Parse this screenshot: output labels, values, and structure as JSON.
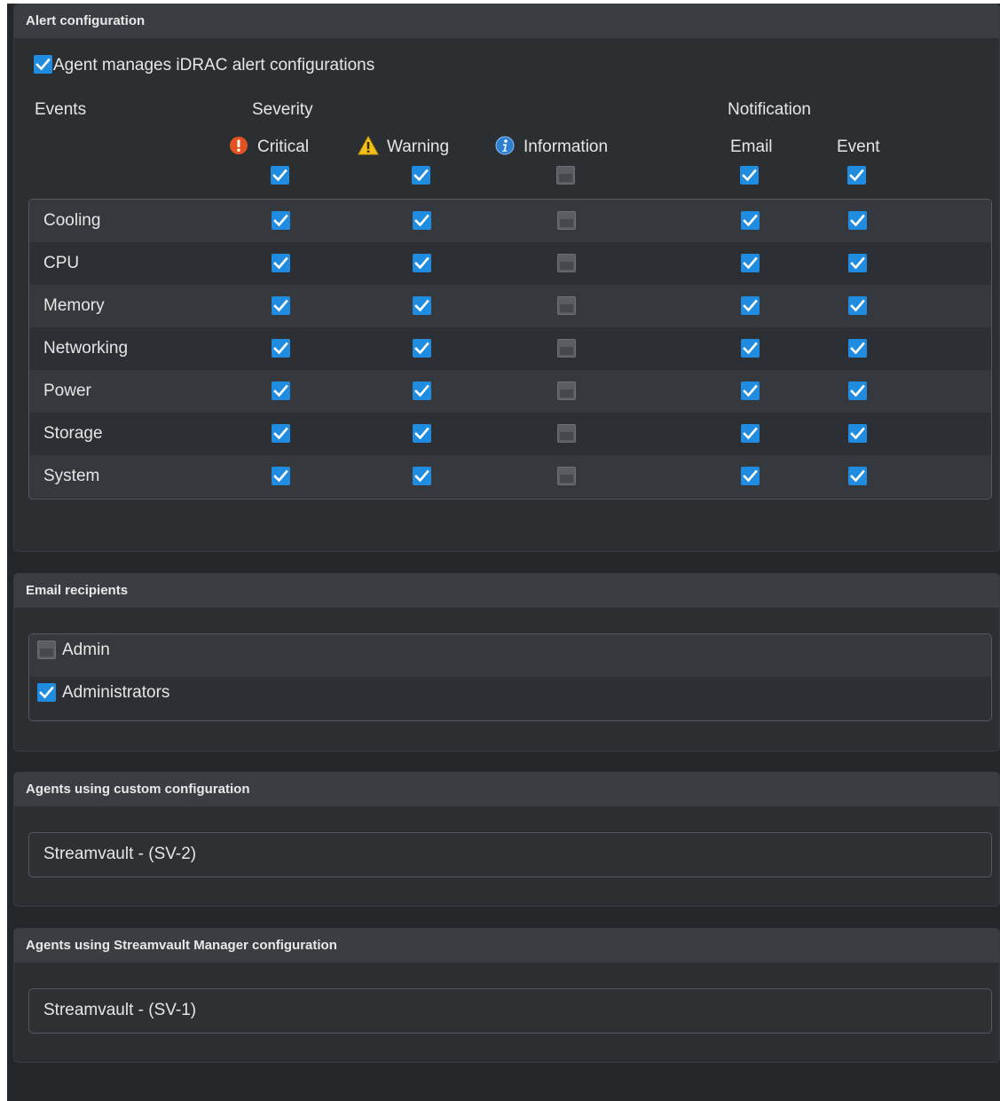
{
  "alert_configuration": {
    "title": "Alert configuration",
    "agent_manages_label": "Agent manages iDRAC alert configurations",
    "agent_manages_checked": true,
    "headers": {
      "events": "Events",
      "severity": "Severity",
      "notification": "Notification",
      "critical": "Critical",
      "warning": "Warning",
      "information": "Information",
      "email": "Email",
      "event": "Event"
    },
    "column_master": {
      "critical": true,
      "warning": true,
      "information": false,
      "email": true,
      "event": true
    },
    "rows": [
      {
        "name": "Cooling",
        "critical": true,
        "warning": true,
        "information": false,
        "email": true,
        "event": true
      },
      {
        "name": "CPU",
        "critical": true,
        "warning": true,
        "information": false,
        "email": true,
        "event": true
      },
      {
        "name": "Memory",
        "critical": true,
        "warning": true,
        "information": false,
        "email": true,
        "event": true
      },
      {
        "name": "Networking",
        "critical": true,
        "warning": true,
        "information": false,
        "email": true,
        "event": true
      },
      {
        "name": "Power",
        "critical": true,
        "warning": true,
        "information": false,
        "email": true,
        "event": true
      },
      {
        "name": "Storage",
        "critical": true,
        "warning": true,
        "information": false,
        "email": true,
        "event": true
      },
      {
        "name": "System",
        "critical": true,
        "warning": true,
        "information": false,
        "email": true,
        "event": true
      }
    ]
  },
  "email_recipients": {
    "title": "Email recipients",
    "items": [
      {
        "label": "Admin",
        "checked": false
      },
      {
        "label": "Administrators",
        "checked": true
      }
    ]
  },
  "custom_agents": {
    "title": "Agents using custom configuration",
    "items": [
      "Streamvault - (SV-2)"
    ]
  },
  "manager_agents": {
    "title": "Agents using Streamvault Manager configuration",
    "items": [
      "Streamvault - (SV-1)"
    ]
  },
  "colors": {
    "accent": "#1f8ce0",
    "critical_icon": "#e2531f",
    "warning_icon": "#f2c21b",
    "info_icon": "#2d7fd3"
  }
}
